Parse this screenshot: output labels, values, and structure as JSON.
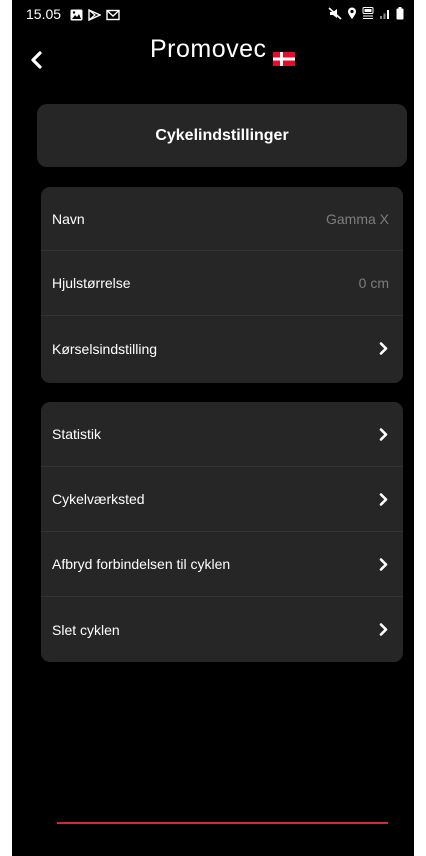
{
  "status_bar": {
    "time": "15.05",
    "left_icons": [
      "image-icon",
      "play-icon",
      "gmail-icon"
    ],
    "right_icons": [
      "mute-icon",
      "location-icon",
      "volte-icon",
      "signal-icon",
      "battery-icon"
    ]
  },
  "header": {
    "logo_text": "Promovec",
    "back_icon": "chevron-left-icon",
    "flag_icon": "danish-flag-icon"
  },
  "title": "Cykelindstillinger",
  "group1": [
    {
      "label": "Navn",
      "value": "Gamma X"
    },
    {
      "label": "Hjulstørrelse",
      "value": "0 cm"
    },
    {
      "label": "Kørselsindstilling",
      "value": ""
    }
  ],
  "group2": [
    {
      "label": "Statistik"
    },
    {
      "label": "Cykelværksted"
    },
    {
      "label": "Afbryd forbindelsen til cyklen"
    },
    {
      "label": "Slet cyklen"
    }
  ],
  "colors": {
    "background": "#000000",
    "card": "#262626",
    "muted_text": "#7d7d7d",
    "accent_red": "#d02b35"
  }
}
